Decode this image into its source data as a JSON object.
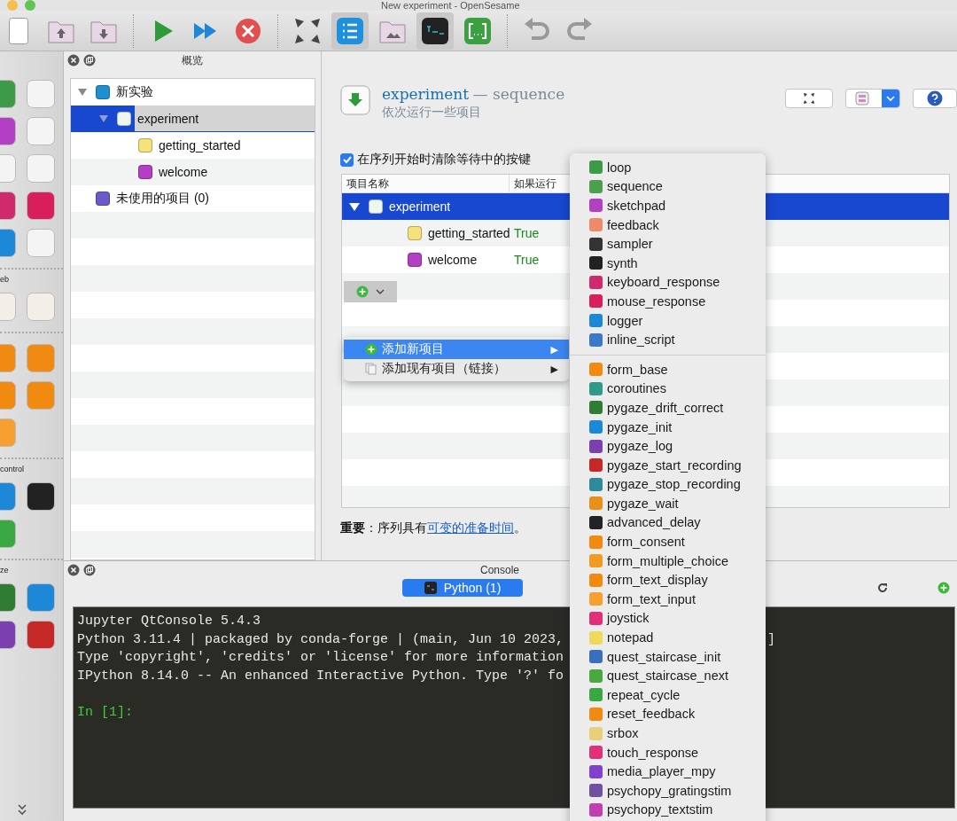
{
  "window": {
    "title": "New experiment - OpenSesame"
  },
  "toolbar": {
    "buttons": [
      {
        "kind": "new",
        "on": false
      },
      {
        "kind": "open",
        "on": false
      },
      {
        "kind": "save",
        "on": false
      },
      {
        "kind": "run",
        "on": false
      },
      {
        "kind": "run-quick",
        "on": false
      },
      {
        "kind": "kill",
        "on": false
      },
      {
        "kind": "fullscreen",
        "on": false
      },
      {
        "kind": "overview",
        "on": true
      },
      {
        "kind": "pool",
        "on": false
      },
      {
        "kind": "console",
        "on": true
      },
      {
        "kind": "variables",
        "on": false
      },
      {
        "kind": "undo",
        "on": false
      },
      {
        "kind": "redo",
        "on": false
      }
    ]
  },
  "sidebar": {
    "labels": [
      "eb",
      "control",
      "ze"
    ]
  },
  "overview": {
    "title": "概览",
    "tree": [
      {
        "label": "新实验",
        "kind": "experiment",
        "expanded": true,
        "selected": false,
        "children": [
          {
            "label": "experiment",
            "kind": "sequence",
            "expanded": true,
            "selected": true,
            "children": [
              {
                "label": "getting_started",
                "kind": "notepad",
                "expanded": false,
                "selected": false
              },
              {
                "label": "welcome",
                "kind": "sketchpad",
                "expanded": false,
                "selected": false
              }
            ]
          }
        ]
      },
      {
        "label": "未使用的项目 (0)",
        "kind": "unused",
        "expanded": false,
        "selected": false
      }
    ]
  },
  "sequence": {
    "name": "experiment",
    "type": "— sequence",
    "description": "依次运行一些项目",
    "flush_keys": {
      "label": "在序列开始时清除等待中的按键",
      "checked": true
    },
    "table": {
      "columns": [
        "项目名称",
        "如果运行"
      ],
      "rows": [
        {
          "name": "experiment",
          "kind": "sequence",
          "run_if": "",
          "expanded": true,
          "selected": true,
          "children": [
            {
              "name": "getting_started",
              "kind": "notepad",
              "run_if": "True",
              "expanded": false,
              "selected": false
            },
            {
              "name": "welcome",
              "kind": "sketchpad",
              "run_if": "True",
              "expanded": false,
              "selected": false
            }
          ]
        }
      ]
    },
    "note": "**重要**：序列具有",
    "note_link": "可变的准备时间",
    "note_end": "。"
  },
  "add_menu": {
    "items": [
      {
        "label": "添加新项目",
        "arrow": "▶",
        "kind": "new",
        "selected": true
      },
      {
        "label": "添加现有项目（链接）",
        "arrow": "▶",
        "kind": "link",
        "selected": false
      }
    ]
  },
  "new_item_menu": {
    "sections": [
      {
        "items": [
          {
            "label": "loop",
            "color": "#3d9b47"
          },
          {
            "label": "sequence",
            "color": "#4c9f4c"
          },
          {
            "label": "sketchpad",
            "color": "#b33fc4"
          },
          {
            "label": "feedback",
            "color": "#ee8a6a"
          },
          {
            "label": "sampler",
            "color": "#333333"
          },
          {
            "label": "synth",
            "color": "#222222"
          },
          {
            "label": "keyboard_response",
            "color": "#cf2a6c"
          },
          {
            "label": "mouse_response",
            "color": "#d81e5b"
          },
          {
            "label": "logger",
            "color": "#1e88d8"
          },
          {
            "label": "inline_script",
            "color": "#3c78c8"
          }
        ]
      },
      {
        "items": [
          {
            "label": "form_base",
            "color": "#f08a10"
          },
          {
            "label": "coroutines",
            "color": "#2f9a8a"
          },
          {
            "label": "pygaze_drift_correct",
            "color": "#2e7d32"
          },
          {
            "label": "pygaze_init",
            "color": "#1e88d8"
          },
          {
            "label": "pygaze_log",
            "color": "#7b3fb0"
          },
          {
            "label": "pygaze_start_recording",
            "color": "#c62828"
          },
          {
            "label": "pygaze_stop_recording",
            "color": "#2f8a9a"
          },
          {
            "label": "pygaze_wait",
            "color": "#e8901a"
          },
          {
            "label": "advanced_delay",
            "color": "#222222"
          },
          {
            "label": "form_consent",
            "color": "#f08a10"
          },
          {
            "label": "form_multiple_choice",
            "color": "#f39a20"
          },
          {
            "label": "form_text_display",
            "color": "#f08a10"
          },
          {
            "label": "form_text_input",
            "color": "#f5a030"
          },
          {
            "label": "joystick",
            "color": "#e0307a"
          },
          {
            "label": "notepad",
            "color": "#efd95a"
          },
          {
            "label": "quest_staircase_init",
            "color": "#3a6fc0"
          },
          {
            "label": "quest_staircase_next",
            "color": "#4aa840"
          },
          {
            "label": "repeat_cycle",
            "color": "#3aa840"
          },
          {
            "label": "reset_feedback",
            "color": "#f08a10"
          },
          {
            "label": "srbox",
            "color": "#e8d078"
          },
          {
            "label": "touch_response",
            "color": "#e0307a"
          },
          {
            "label": "media_player_mpy",
            "color": "#8040d0"
          },
          {
            "label": "psychopy_gratingstim",
            "color": "#7050a0"
          },
          {
            "label": "psychopy_textstim",
            "color": "#c040b0"
          }
        ]
      }
    ]
  },
  "console": {
    "title": "Console",
    "tabs": [
      {
        "label": "Python (1)",
        "selected": true
      }
    ],
    "lines": [
      {
        "text": "Jupyter QtConsole 5.4.3",
        "kind": "output"
      },
      {
        "text": "Python 3.11.4 | packaged by conda-forge | (main, Jun 10 2023,",
        "tail": "]",
        "kind": "output"
      },
      {
        "text": "Type 'copyright', 'credits' or 'license' for more information",
        "kind": "output"
      },
      {
        "text": "IPython 8.14.0 -- An enhanced Interactive Python. Type '?' fo",
        "kind": "output"
      },
      {
        "kind": "blank"
      },
      {
        "text": "In [1]:",
        "kind": "prompt"
      }
    ]
  }
}
